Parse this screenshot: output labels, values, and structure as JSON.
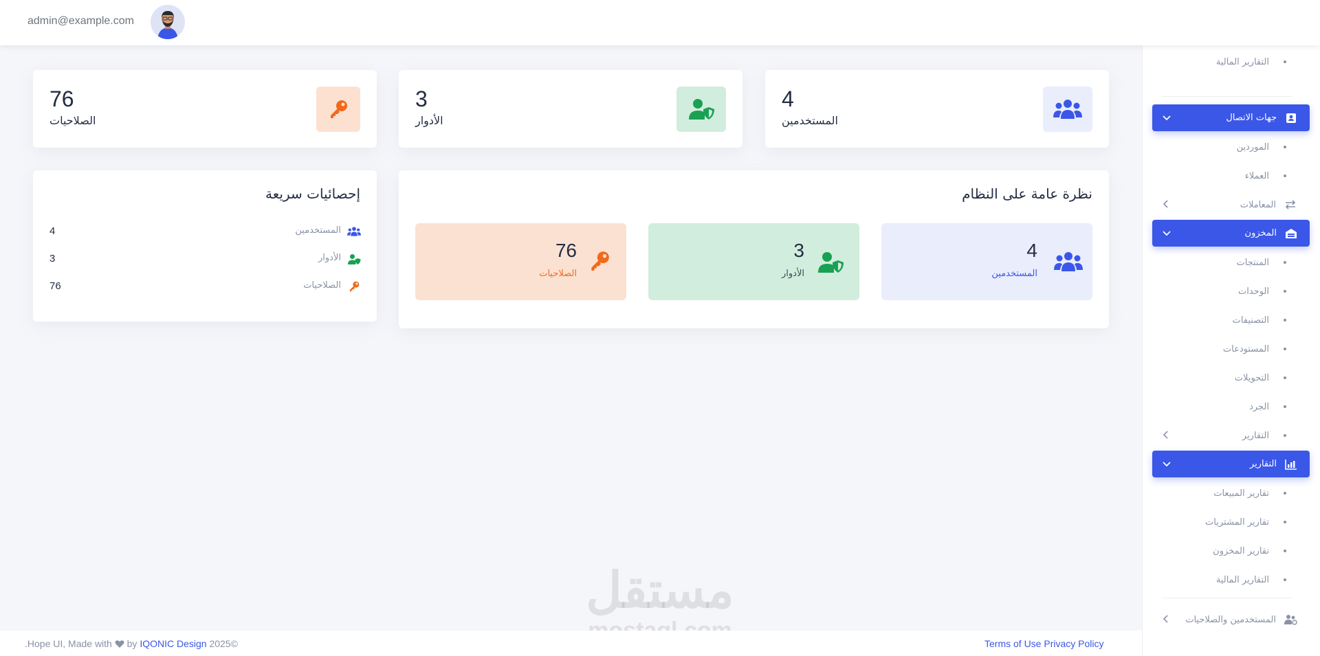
{
  "header": {
    "email": "admin@example.com",
    "avatar_alt": "avatar"
  },
  "stats": [
    {
      "value": "4",
      "label": "المستخدمين",
      "icon": "users-icon",
      "color": "#3a57e8",
      "bg": "#e9edfc"
    },
    {
      "value": "3",
      "label": "الأدوار",
      "icon": "user-shield-icon",
      "color": "#1aa053",
      "bg": "#d1eddd"
    },
    {
      "value": "76",
      "label": "الصلاحيات",
      "icon": "key-icon",
      "color": "#f16a1b",
      "bg": "#fce1d1"
    }
  ],
  "overview": {
    "title": "نظرة عامة على النظام",
    "items": [
      {
        "value": "4",
        "label": "المستخدمين",
        "color": "#3a57e8",
        "bg": "#e9edfc"
      },
      {
        "value": "3",
        "label": "الأدوار",
        "color": "#1aa053",
        "bg": "#d1eddd"
      },
      {
        "value": "76",
        "label": "الصلاحيات",
        "color": "#f16a1b",
        "bg": "#fbe1d2"
      }
    ]
  },
  "quick_stats": {
    "title": "إحصائيات سريعة",
    "rows": [
      {
        "label": "المستخدمين",
        "value": "4"
      },
      {
        "label": "الأدوار",
        "value": "3"
      },
      {
        "label": "الصلاحيات",
        "value": "76"
      }
    ]
  },
  "sidebar": {
    "items": [
      {
        "label": "التقارير المالية",
        "kind": "sub"
      },
      {
        "label": "جهات الاتصال",
        "kind": "active",
        "icon": "contacts-icon"
      },
      {
        "label": "الموردين",
        "kind": "sub"
      },
      {
        "label": "العملاء",
        "kind": "sub"
      },
      {
        "label": "المعاملات",
        "kind": "main",
        "icon": "exchange-icon"
      },
      {
        "label": "المخزون",
        "kind": "active",
        "icon": "warehouse-icon"
      },
      {
        "label": "المنتجات",
        "kind": "sub"
      },
      {
        "label": "الوحدات",
        "kind": "sub"
      },
      {
        "label": "التصنيفات",
        "kind": "sub"
      },
      {
        "label": "المستودعات",
        "kind": "sub"
      },
      {
        "label": "التحويلات",
        "kind": "sub"
      },
      {
        "label": "الجرد",
        "kind": "sub"
      },
      {
        "label": "التقارير",
        "kind": "sub"
      },
      {
        "label": "التقارير",
        "kind": "active",
        "icon": "chart-icon"
      },
      {
        "label": "تقارير المبيعات",
        "kind": "sub"
      },
      {
        "label": "تقارير المشتريات",
        "kind": "sub"
      },
      {
        "label": "تقارير المخزون",
        "kind": "sub"
      },
      {
        "label": "التقارير المالية",
        "kind": "sub"
      },
      {
        "label": "المستخدمين والصلاحيات",
        "kind": "main",
        "icon": "users-cog-icon"
      }
    ]
  },
  "footer": {
    "copyright_prefix": ".Hope UI, Made with",
    "by": "by",
    "brand": "IQONIC Design",
    "year": "2025©",
    "links": "Terms of Use Privacy Policy"
  },
  "watermark": {
    "arabic": "مستقل",
    "latin": "mostaql.com"
  }
}
